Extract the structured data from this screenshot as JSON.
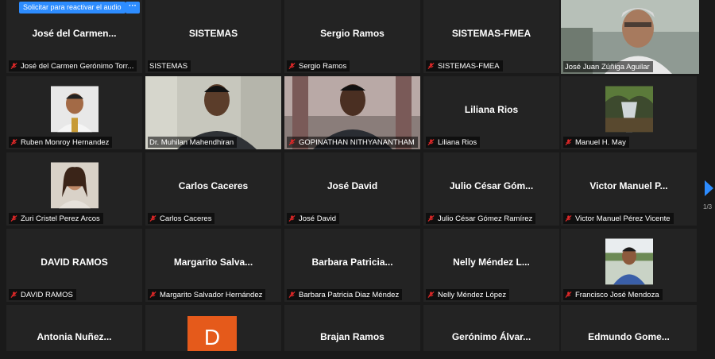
{
  "toolbar": {
    "request_audio_label": "Solicitar para reactivar el audio",
    "more_label": "···"
  },
  "pagination": {
    "indicator": "1/3"
  },
  "participants": [
    {
      "display": "José del Carmen...",
      "label": "José del Carmen Gerónimo Torr...",
      "video": false
    },
    {
      "display": "SISTEMAS",
      "label": "SISTEMAS",
      "video": false
    },
    {
      "display": "Sergio Ramos",
      "label": "Sergio Ramos",
      "video": false
    },
    {
      "display": "SISTEMAS-FMEA",
      "label": "SISTEMAS-FMEA",
      "video": false
    },
    {
      "display": "",
      "label": "José  Juan Zúñiga Aguilar",
      "video": true,
      "active_speaker": true
    },
    {
      "display": "",
      "label": "Ruben Monroy Hernandez",
      "video": "thumb"
    },
    {
      "display": "",
      "label": "Dr. Muhilan Mahendhiran",
      "video": true
    },
    {
      "display": "",
      "label": "GOPINATHAN NITHYANANTHAM",
      "video": true
    },
    {
      "display": "Liliana Rios",
      "label": "Liliana Rios",
      "video": false
    },
    {
      "display": "",
      "label": "Manuel H. May",
      "video": "thumb"
    },
    {
      "display": "",
      "label": "Zuri Cristel Perez Arcos",
      "video": "thumb"
    },
    {
      "display": "Carlos Caceres",
      "label": "Carlos Caceres",
      "video": false
    },
    {
      "display": "José David",
      "label": "José David",
      "video": false
    },
    {
      "display": "Julio César Góm...",
      "label": "Julio César Gómez Ramírez",
      "video": false
    },
    {
      "display": "Victor Manuel P...",
      "label": "Victor Manuel Pérez Vicente",
      "video": false
    },
    {
      "display": "DAVID RAMOS",
      "label": "DAVID RAMOS",
      "video": false
    },
    {
      "display": "Margarito Salva...",
      "label": "Margarito Salvador Hernández",
      "video": false
    },
    {
      "display": "Barbara Patricia...",
      "label": "Barbara Patricia Diaz Méndez",
      "video": false
    },
    {
      "display": "Nelly Méndez L...",
      "label": "Nelly Méndez López",
      "video": false
    },
    {
      "display": "",
      "label": "Francisco José Mendoza",
      "video": "thumb"
    },
    {
      "display": "Antonia Nuñez...",
      "label": "",
      "video": false
    },
    {
      "display": "",
      "label": "",
      "video": "avatar"
    },
    {
      "display": "Brajan Ramos",
      "label": "",
      "video": false
    },
    {
      "display": "Gerónimo Álvar...",
      "label": "",
      "video": false
    },
    {
      "display": "Edmundo Gome...",
      "label": "",
      "video": false
    }
  ],
  "avatar_letter": "D",
  "colors": {
    "accent": "#2d8cff",
    "active_speaker": "#c3e86a",
    "muted_icon": "#e02828",
    "avatar_bg": "#e55a1b"
  }
}
